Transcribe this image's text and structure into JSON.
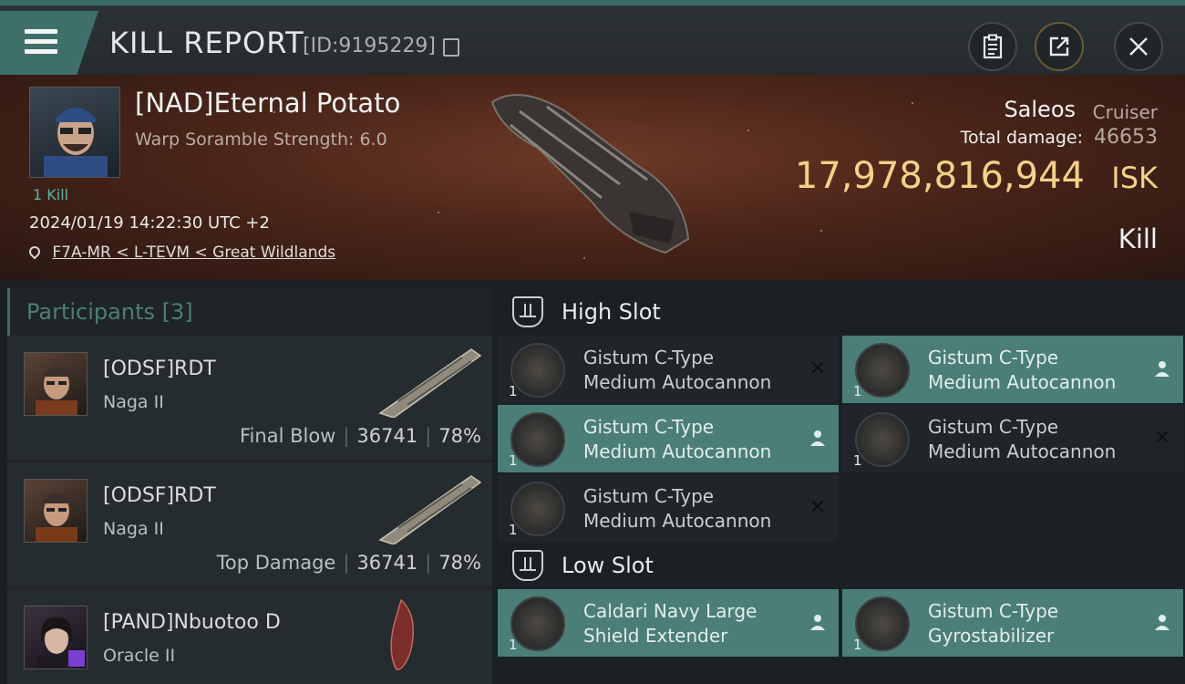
{
  "header": {
    "title": "KILL REPORT",
    "report_id": "[ID:9195229]",
    "icons": [
      "menu-icon",
      "copy-icon",
      "clipboard-icon",
      "share-icon",
      "close-icon"
    ]
  },
  "victim": {
    "name": "[NAD]Eternal Potato",
    "warp_scramble": "Warp Soramble Strength: 6.0",
    "kills_label": "1 Kill",
    "datetime": "2024/01/19 14:22:30 UTC +2",
    "location": "F7A-MR < L-TEVM < Great Wildlands",
    "ship_name": "Saleos",
    "ship_class": "Cruiser",
    "total_damage_label": "Total damage:",
    "total_damage": "46653",
    "isk_value": "17,978,816,944",
    "isk_unit": "ISK",
    "kill_type": "Kill"
  },
  "participants": {
    "label": "Participants",
    "count": "[3]",
    "rows": [
      {
        "name": "[ODSF]RDT",
        "ship": "Naga II",
        "role": "Final Blow",
        "damage": "36741",
        "percent": "78%"
      },
      {
        "name": "[ODSF]RDT",
        "ship": "Naga II",
        "role": "Top Damage",
        "damage": "36741",
        "percent": "78%"
      },
      {
        "name": "[PAND]Nbuotoo D",
        "ship": "Oracle II",
        "role": "",
        "damage": "",
        "percent": ""
      }
    ]
  },
  "slots": {
    "high": {
      "label": "High Slot",
      "modules": [
        {
          "line1": "Gistum C-Type",
          "line2": "Medium Autocannon",
          "qty": "1",
          "status": "destroyed"
        },
        {
          "line1": "Gistum C-Type",
          "line2": "Medium Autocannon",
          "qty": "1",
          "status": "dropped"
        },
        {
          "line1": "Gistum C-Type",
          "line2": "Medium Autocannon",
          "qty": "1",
          "status": "dropped"
        },
        {
          "line1": "Gistum C-Type",
          "line2": "Medium Autocannon",
          "qty": "1",
          "status": "destroyed"
        },
        {
          "line1": "Gistum C-Type",
          "line2": "Medium Autocannon",
          "qty": "1",
          "status": "destroyed"
        }
      ]
    },
    "low": {
      "label": "Low Slot",
      "modules": [
        {
          "line1": "Caldari Navy Large",
          "line2": "Shield Extender",
          "qty": "1",
          "status": "dropped"
        },
        {
          "line1": "Gistum C-Type",
          "line2": "Gyrostabilizer",
          "qty": "1",
          "status": "dropped"
        }
      ]
    }
  },
  "colors": {
    "accent": "#4b7e77",
    "isk": "#f3d18a",
    "banner": "#4a2519"
  }
}
